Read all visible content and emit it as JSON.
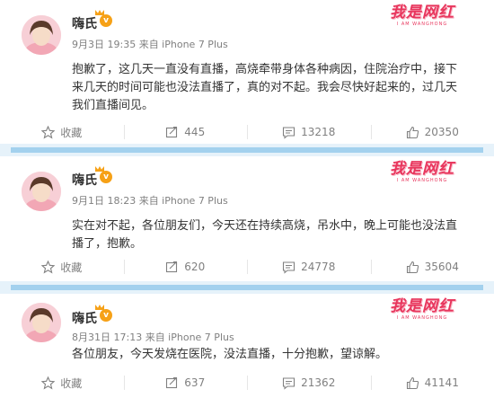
{
  "posts": [
    {
      "user": "嗨氏",
      "vip_badge": "v",
      "meta": "9月3日 19:35 来自 iPhone 7 Plus",
      "content": "抱歉了，这几天一直没有直播，高烧牵带身体各种病因，住院治疗中，接下来几天的时间可能也没法直播了，真的对不起。我会尽快好起来的，过几天我们直播间见。",
      "watermark": "我是网红",
      "watermark_sub": "I AM WANGHONG",
      "actions": {
        "favorite": "收藏",
        "repost": "445",
        "comment": "13218",
        "like": "20350"
      }
    },
    {
      "user": "嗨氏",
      "vip_badge": "v",
      "meta": "9月1日 18:23 来自 iPhone 7 Plus",
      "content": "实在对不起，各位朋友们，今天还在持续高烧，吊水中，晚上可能也没法直播了，抱歉。",
      "watermark": "我是网红",
      "watermark_sub": "I AM WANGHONG",
      "actions": {
        "favorite": "收藏",
        "repost": "620",
        "comment": "24778",
        "like": "35604"
      }
    },
    {
      "user": "嗨氏",
      "vip_badge": "v",
      "meta": "8月31日 17:13 来自 iPhone 7 Plus",
      "content": "各位朋友，今天发烧在医院，没法直播，十分抱歉，望谅解。",
      "watermark": "我是网红",
      "watermark_sub": "I AM WANGHONG",
      "actions": {
        "favorite": "收藏",
        "repost": "637",
        "comment": "21362",
        "like": "41141"
      }
    }
  ],
  "colors": {
    "accent_watermark": "#e8365d",
    "separator": "#a3d1ee",
    "meta_text": "#808080",
    "vip_badge": "#f6a117"
  },
  "icons": [
    "star-icon",
    "repost-icon",
    "comment-icon",
    "like-icon"
  ]
}
